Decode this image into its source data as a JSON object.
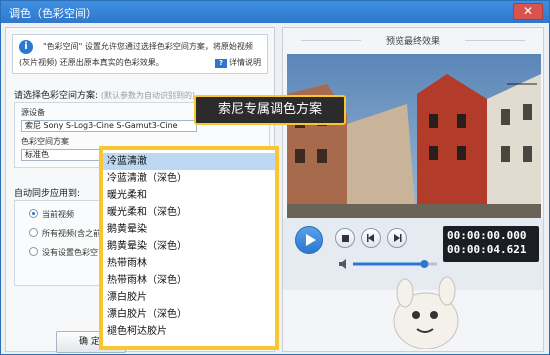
{
  "window": {
    "title": "调色（色彩空间）",
    "close_label": "✕"
  },
  "info": {
    "line1": "\"色彩空间\" 设置允许您通过选择色彩空间方案，将原始视频",
    "line2": "(灰片视频) 还原出原本真实的色彩效果。",
    "help_label": "详情说明"
  },
  "scheme_section": {
    "title": "请选择色彩空间方案:",
    "hint": "(默认参数为自动识别到的)"
  },
  "source_device": {
    "label": "源设备",
    "value": "索尼 Sony S-Log3-Cine S-Gamut3-Cine"
  },
  "color_space": {
    "label": "色彩空间方案",
    "value": "标准色"
  },
  "sync": {
    "title": "自动同步应用到:",
    "options": [
      "当前视频",
      "所有视频(含之前",
      "没有设置色彩空"
    ],
    "selected_index": 0
  },
  "ok_button": "确 定",
  "preview": {
    "title": "预览最终效果",
    "time_current": "00:00:00.000",
    "time_total": "00:00:04.621",
    "volume_level": 0.85
  },
  "callout": "索尼专属调色方案",
  "dropdown": {
    "options": [
      "冷蓝清澈",
      "冷蓝清澈（深色）",
      "暖光柔和",
      "暖光柔和（深色）",
      "鹅黄晕染",
      "鹅黄晕染（深色）",
      "热带雨林",
      "热带雨林（深色）",
      "漂白胶片",
      "漂白胶片（深色）",
      "褪色柯达胶片"
    ],
    "selected_index": 0
  },
  "colors": {
    "accent": "#2b78d0",
    "highlight": "#f7c631",
    "title_bar": "#3a87db"
  }
}
